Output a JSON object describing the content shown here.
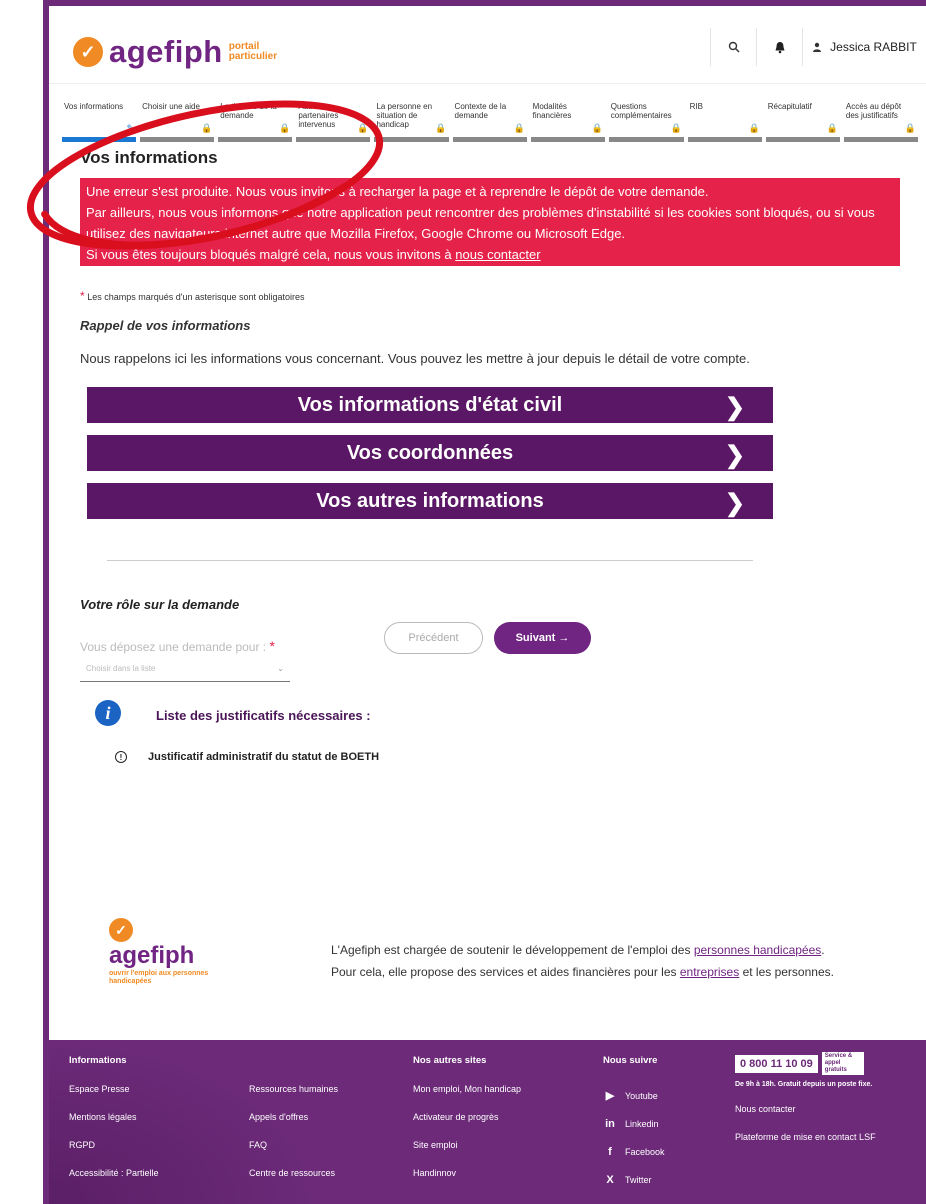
{
  "header": {
    "logo_text": "agefiph",
    "logo_sub1": "portail",
    "logo_sub2": "particulier",
    "user_name": "Jessica RABBIT",
    "icons": [
      "search-icon",
      "bell-icon",
      "user-icon"
    ]
  },
  "steps": [
    {
      "label": "Vos informations",
      "active": true,
      "icon": "pencil-icon"
    },
    {
      "label": "Choisir une aide",
      "icon": "lock-icon"
    },
    {
      "label": "Le titulaire de la demande",
      "icon": "lock-icon"
    },
    {
      "label": "Autres partenaires intervenus",
      "icon": "lock-icon"
    },
    {
      "label": "La personne en situation de handicap",
      "icon": "lock-icon"
    },
    {
      "label": "Contexte de la demande",
      "icon": "lock-icon"
    },
    {
      "label": "Modalités financières",
      "icon": "lock-icon"
    },
    {
      "label": "Questions complémentaires",
      "icon": "lock-icon"
    },
    {
      "label": "RIB",
      "icon": "lock-icon"
    },
    {
      "label": "Récapitulatif",
      "icon": "lock-icon"
    },
    {
      "label": "Accès au dépôt des justificatifs",
      "icon": "lock-icon"
    }
  ],
  "page_title": "Vos informations",
  "error": {
    "line1": "Une erreur s'est produite. Nous vous invitons à recharger la page et à reprendre le dépôt de votre demande.",
    "line2": "Par ailleurs, nous vous informons que notre application peut rencontrer des problèmes d'instabilité si les cookies sont bloqués, ou si vous utilisez des navigateurs internet autre que Mozilla Firefox, Google Chrome ou Microsoft Edge.",
    "line3_prefix": "Si vous êtes toujours bloqués malgré cela, nous vous invitons à ",
    "line3_link": "nous contacter"
  },
  "required_note": "Les champs marqués d'un asterisque sont obligatoires",
  "rappel": {
    "title": "Rappel de vos informations",
    "text": "Nous rappelons ici les informations vous concernant. Vous pouvez les mettre à jour depuis le détail de votre compte."
  },
  "accordions": [
    "Vos informations d'état civil",
    "Vos coordonnées",
    "Vos autres informations"
  ],
  "role": {
    "title": "Votre rôle sur la demande",
    "deposit_label": "Vous déposez une demande pour :",
    "select_placeholder": "Choisir dans la liste"
  },
  "buttons": {
    "prev": "Précédent",
    "next": "Suivant →"
  },
  "justificatifs": {
    "title": "Liste des justificatifs nécessaires :",
    "items": [
      "Justificatif administratif du statut de BOETH"
    ]
  },
  "footer_about": {
    "logo_text": "agefiph",
    "logo_sub": "ouvrir l'emploi aux personnes handicapées",
    "line1_prefix": "L'Agefiph est chargée de soutenir le développement de l'emploi des ",
    "line1_link": "personnes handicapées",
    "line1_suffix": ".",
    "line2_prefix": "Pour cela, elle propose des services et aides financières pour les ",
    "line2_link": "entreprises",
    "line2_suffix": " et les personnes."
  },
  "footer": {
    "col1": {
      "title": "Informations",
      "items": [
        "Espace Presse",
        "Mentions légales",
        "RGPD",
        "Accessibilité : Partielle"
      ]
    },
    "col2": {
      "items": [
        "Ressources humaines",
        "Appels d'offres",
        "FAQ",
        "Centre de ressources"
      ]
    },
    "col3": {
      "title": "Nos autres sites",
      "items": [
        "Mon emploi, Mon handicap",
        "Activateur de progrès",
        "Site emploi",
        "Handinnov"
      ]
    },
    "col4": {
      "title": "Nous suivre",
      "items": [
        {
          "label": "Youtube",
          "icon": "youtube-icon"
        },
        {
          "label": "Linkedin",
          "icon": "linkedin-icon"
        },
        {
          "label": "Facebook",
          "icon": "facebook-icon"
        },
        {
          "label": "Twitter",
          "icon": "x-icon"
        }
      ]
    },
    "col5": {
      "phone": "0 800 11 10 09",
      "phone_tag": "Service & appel gratuits",
      "hours": "De 9h à 18h. Gratuit depuis un poste fixe.",
      "links": [
        "Nous contacter",
        "Plateforme de mise en contact LSF"
      ]
    }
  },
  "colors": {
    "brand": "#702582",
    "accent": "#f08a24",
    "error": "#e5224a",
    "footer": "#6c2a78"
  }
}
